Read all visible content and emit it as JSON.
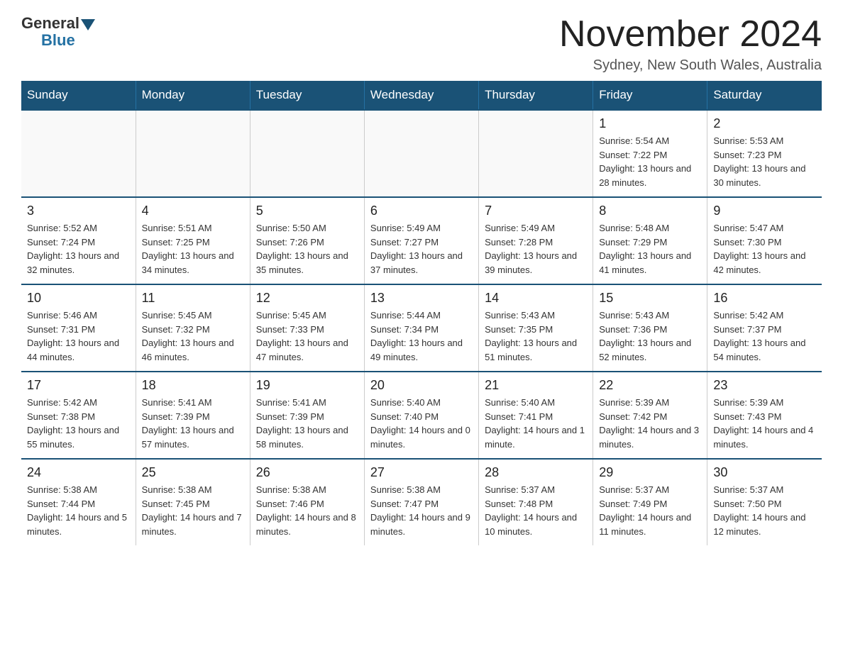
{
  "header": {
    "logo_general": "General",
    "logo_blue": "Blue",
    "month_title": "November 2024",
    "location": "Sydney, New South Wales, Australia"
  },
  "days_of_week": [
    "Sunday",
    "Monday",
    "Tuesday",
    "Wednesday",
    "Thursday",
    "Friday",
    "Saturday"
  ],
  "weeks": [
    {
      "days": [
        {
          "num": "",
          "info": ""
        },
        {
          "num": "",
          "info": ""
        },
        {
          "num": "",
          "info": ""
        },
        {
          "num": "",
          "info": ""
        },
        {
          "num": "",
          "info": ""
        },
        {
          "num": "1",
          "info": "Sunrise: 5:54 AM\nSunset: 7:22 PM\nDaylight: 13 hours and 28 minutes."
        },
        {
          "num": "2",
          "info": "Sunrise: 5:53 AM\nSunset: 7:23 PM\nDaylight: 13 hours and 30 minutes."
        }
      ]
    },
    {
      "days": [
        {
          "num": "3",
          "info": "Sunrise: 5:52 AM\nSunset: 7:24 PM\nDaylight: 13 hours and 32 minutes."
        },
        {
          "num": "4",
          "info": "Sunrise: 5:51 AM\nSunset: 7:25 PM\nDaylight: 13 hours and 34 minutes."
        },
        {
          "num": "5",
          "info": "Sunrise: 5:50 AM\nSunset: 7:26 PM\nDaylight: 13 hours and 35 minutes."
        },
        {
          "num": "6",
          "info": "Sunrise: 5:49 AM\nSunset: 7:27 PM\nDaylight: 13 hours and 37 minutes."
        },
        {
          "num": "7",
          "info": "Sunrise: 5:49 AM\nSunset: 7:28 PM\nDaylight: 13 hours and 39 minutes."
        },
        {
          "num": "8",
          "info": "Sunrise: 5:48 AM\nSunset: 7:29 PM\nDaylight: 13 hours and 41 minutes."
        },
        {
          "num": "9",
          "info": "Sunrise: 5:47 AM\nSunset: 7:30 PM\nDaylight: 13 hours and 42 minutes."
        }
      ]
    },
    {
      "days": [
        {
          "num": "10",
          "info": "Sunrise: 5:46 AM\nSunset: 7:31 PM\nDaylight: 13 hours and 44 minutes."
        },
        {
          "num": "11",
          "info": "Sunrise: 5:45 AM\nSunset: 7:32 PM\nDaylight: 13 hours and 46 minutes."
        },
        {
          "num": "12",
          "info": "Sunrise: 5:45 AM\nSunset: 7:33 PM\nDaylight: 13 hours and 47 minutes."
        },
        {
          "num": "13",
          "info": "Sunrise: 5:44 AM\nSunset: 7:34 PM\nDaylight: 13 hours and 49 minutes."
        },
        {
          "num": "14",
          "info": "Sunrise: 5:43 AM\nSunset: 7:35 PM\nDaylight: 13 hours and 51 minutes."
        },
        {
          "num": "15",
          "info": "Sunrise: 5:43 AM\nSunset: 7:36 PM\nDaylight: 13 hours and 52 minutes."
        },
        {
          "num": "16",
          "info": "Sunrise: 5:42 AM\nSunset: 7:37 PM\nDaylight: 13 hours and 54 minutes."
        }
      ]
    },
    {
      "days": [
        {
          "num": "17",
          "info": "Sunrise: 5:42 AM\nSunset: 7:38 PM\nDaylight: 13 hours and 55 minutes."
        },
        {
          "num": "18",
          "info": "Sunrise: 5:41 AM\nSunset: 7:39 PM\nDaylight: 13 hours and 57 minutes."
        },
        {
          "num": "19",
          "info": "Sunrise: 5:41 AM\nSunset: 7:39 PM\nDaylight: 13 hours and 58 minutes."
        },
        {
          "num": "20",
          "info": "Sunrise: 5:40 AM\nSunset: 7:40 PM\nDaylight: 14 hours and 0 minutes."
        },
        {
          "num": "21",
          "info": "Sunrise: 5:40 AM\nSunset: 7:41 PM\nDaylight: 14 hours and 1 minute."
        },
        {
          "num": "22",
          "info": "Sunrise: 5:39 AM\nSunset: 7:42 PM\nDaylight: 14 hours and 3 minutes."
        },
        {
          "num": "23",
          "info": "Sunrise: 5:39 AM\nSunset: 7:43 PM\nDaylight: 14 hours and 4 minutes."
        }
      ]
    },
    {
      "days": [
        {
          "num": "24",
          "info": "Sunrise: 5:38 AM\nSunset: 7:44 PM\nDaylight: 14 hours and 5 minutes."
        },
        {
          "num": "25",
          "info": "Sunrise: 5:38 AM\nSunset: 7:45 PM\nDaylight: 14 hours and 7 minutes."
        },
        {
          "num": "26",
          "info": "Sunrise: 5:38 AM\nSunset: 7:46 PM\nDaylight: 14 hours and 8 minutes."
        },
        {
          "num": "27",
          "info": "Sunrise: 5:38 AM\nSunset: 7:47 PM\nDaylight: 14 hours and 9 minutes."
        },
        {
          "num": "28",
          "info": "Sunrise: 5:37 AM\nSunset: 7:48 PM\nDaylight: 14 hours and 10 minutes."
        },
        {
          "num": "29",
          "info": "Sunrise: 5:37 AM\nSunset: 7:49 PM\nDaylight: 14 hours and 11 minutes."
        },
        {
          "num": "30",
          "info": "Sunrise: 5:37 AM\nSunset: 7:50 PM\nDaylight: 14 hours and 12 minutes."
        }
      ]
    }
  ]
}
